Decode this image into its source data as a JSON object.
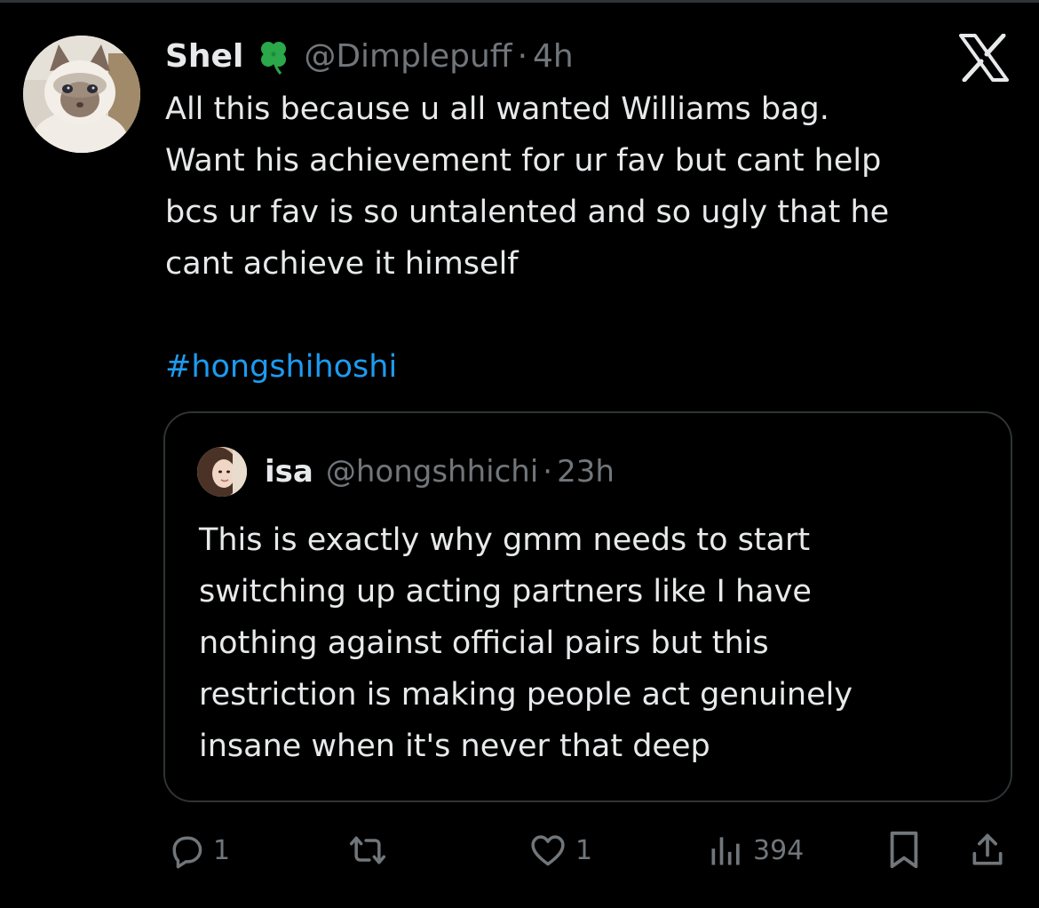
{
  "tweet": {
    "author_name": "Shel",
    "author_handle": "@Dimplepuff",
    "separator": "·",
    "time": "4h",
    "text": "All this because u all wanted Williams bag.\nWant his achievement for ur fav but cant help\nbcs ur fav is so untalented and so ugly that he\ncant achieve it himself",
    "hashtag": "#hongshihoshi",
    "badge_icon": "clover-icon",
    "platform_icon": "x-logo-icon"
  },
  "quoted_tweet": {
    "author_name": "isa",
    "author_handle": "@hongshhichi",
    "separator": "·",
    "time": "23h",
    "text": "This is exactly why gmm needs to start\nswitching up acting partners like I have\nnothing against official pairs but this\nrestriction is making people act genuinely\ninsane when it's never that deep"
  },
  "actions": {
    "replies": "1",
    "retweets": "",
    "likes": "1",
    "views": "394"
  },
  "colors": {
    "background": "#000000",
    "text": "#e7e9ea",
    "muted": "#71767b",
    "link": "#1d9bf0",
    "border": "#2f3336",
    "clover": "#2aa84a"
  }
}
